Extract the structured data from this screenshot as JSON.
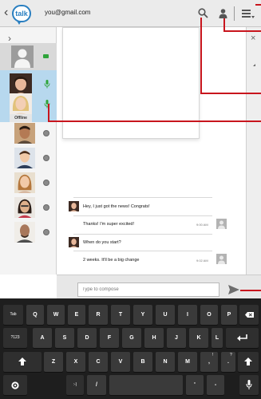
{
  "header": {
    "back": "‹",
    "app_logo": "talk",
    "account_email": "you@gmail.com",
    "icons": [
      "search-icon",
      "add-contact-icon",
      "menu-icon"
    ]
  },
  "contacts": {
    "expand": "›",
    "offline_label": "Offline",
    "status_colors": {
      "available": "#2fa43a",
      "offline": "#8a8a8a",
      "selected_bg": "#b7d8ee"
    }
  },
  "chat_pane": {
    "close": "×"
  },
  "messages": [
    {
      "text": "Hey, I just got the news! Congrats!",
      "time": "",
      "side": "left"
    },
    {
      "text": "Thanks! I'm super excited!",
      "time": "9:00 AM",
      "side": "right"
    },
    {
      "text": "When do you start?",
      "time": "",
      "side": "left"
    },
    {
      "text": "2 weeks. It'll be a big change",
      "time": "9:02 AM",
      "side": "right"
    }
  ],
  "compose": {
    "placeholder": "Type to compose"
  },
  "keyboard": {
    "row1": [
      "Tab",
      "Q",
      "W",
      "E",
      "R",
      "T",
      "Y",
      "U",
      "I",
      "O",
      "P"
    ],
    "row2": [
      "?123",
      "A",
      "S",
      "D",
      "F",
      "G",
      "H",
      "J",
      "K",
      "L"
    ],
    "row3": [
      "Z",
      "X",
      "C",
      "V",
      "B",
      "N",
      "M",
      ",",
      "."
    ],
    "row3_marks": [
      "!",
      "?"
    ],
    "row4": [
      ":-)",
      "/",
      "'",
      "-"
    ]
  },
  "callout_color": "#c8151d"
}
